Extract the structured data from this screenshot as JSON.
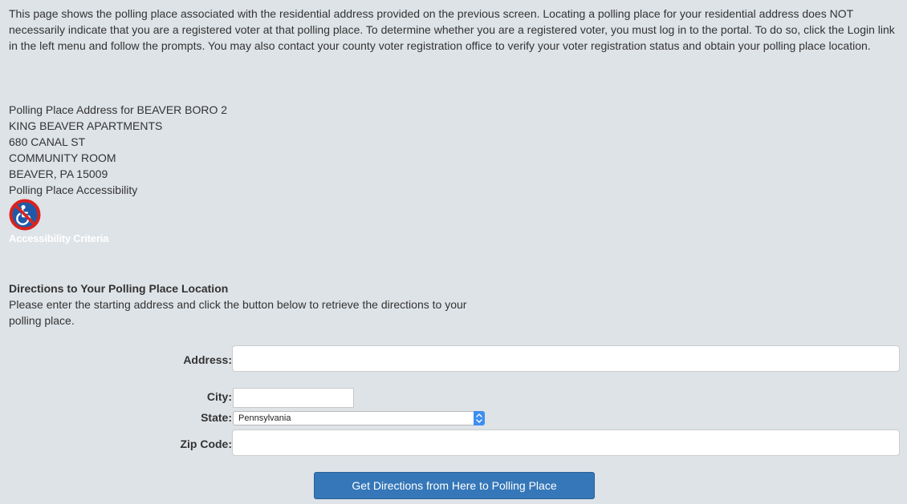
{
  "intro_text": "This page shows the polling place associated with the residential address provided on the previous screen. Locating a polling place for your residential address does NOT necessarily indicate that you are a registered voter at that polling place. To determine whether you are a registered voter, you must log in to the portal. To do so, click the Login link in the left menu and follow the prompts. You may also contact your county voter registration office to verify your voter registration status and obtain your polling place location.",
  "polling_place": {
    "heading": "Polling Place Address for BEAVER BORO 2",
    "lines": [
      "KING BEAVER APARTMENTS",
      "680 CANAL ST",
      "COMMUNITY ROOM",
      "BEAVER, PA  15009"
    ],
    "accessibility_label": "Polling Place Accessibility",
    "accessibility_icon": "wheelchair-not-accessible-icon",
    "accessibility_link": "Accessibility Criteria"
  },
  "directions": {
    "heading": "Directions to Your Polling Place Location",
    "instructions": "Please enter the starting address and click the button below to retrieve the directions to your polling place.",
    "address_label": "Address:",
    "address_value": "",
    "city_label": "City:",
    "city_value": "",
    "state_label": "State:",
    "state_selected": "Pennsylvania",
    "zip_label": "Zip Code:",
    "zip_value": "",
    "submit_label": "Get Directions from Here to Polling Place"
  },
  "colors": {
    "background": "#dee3e7",
    "button": "#3577b8",
    "prohibited_red": "#d9231f",
    "icon_blue": "#1f5aa8"
  }
}
